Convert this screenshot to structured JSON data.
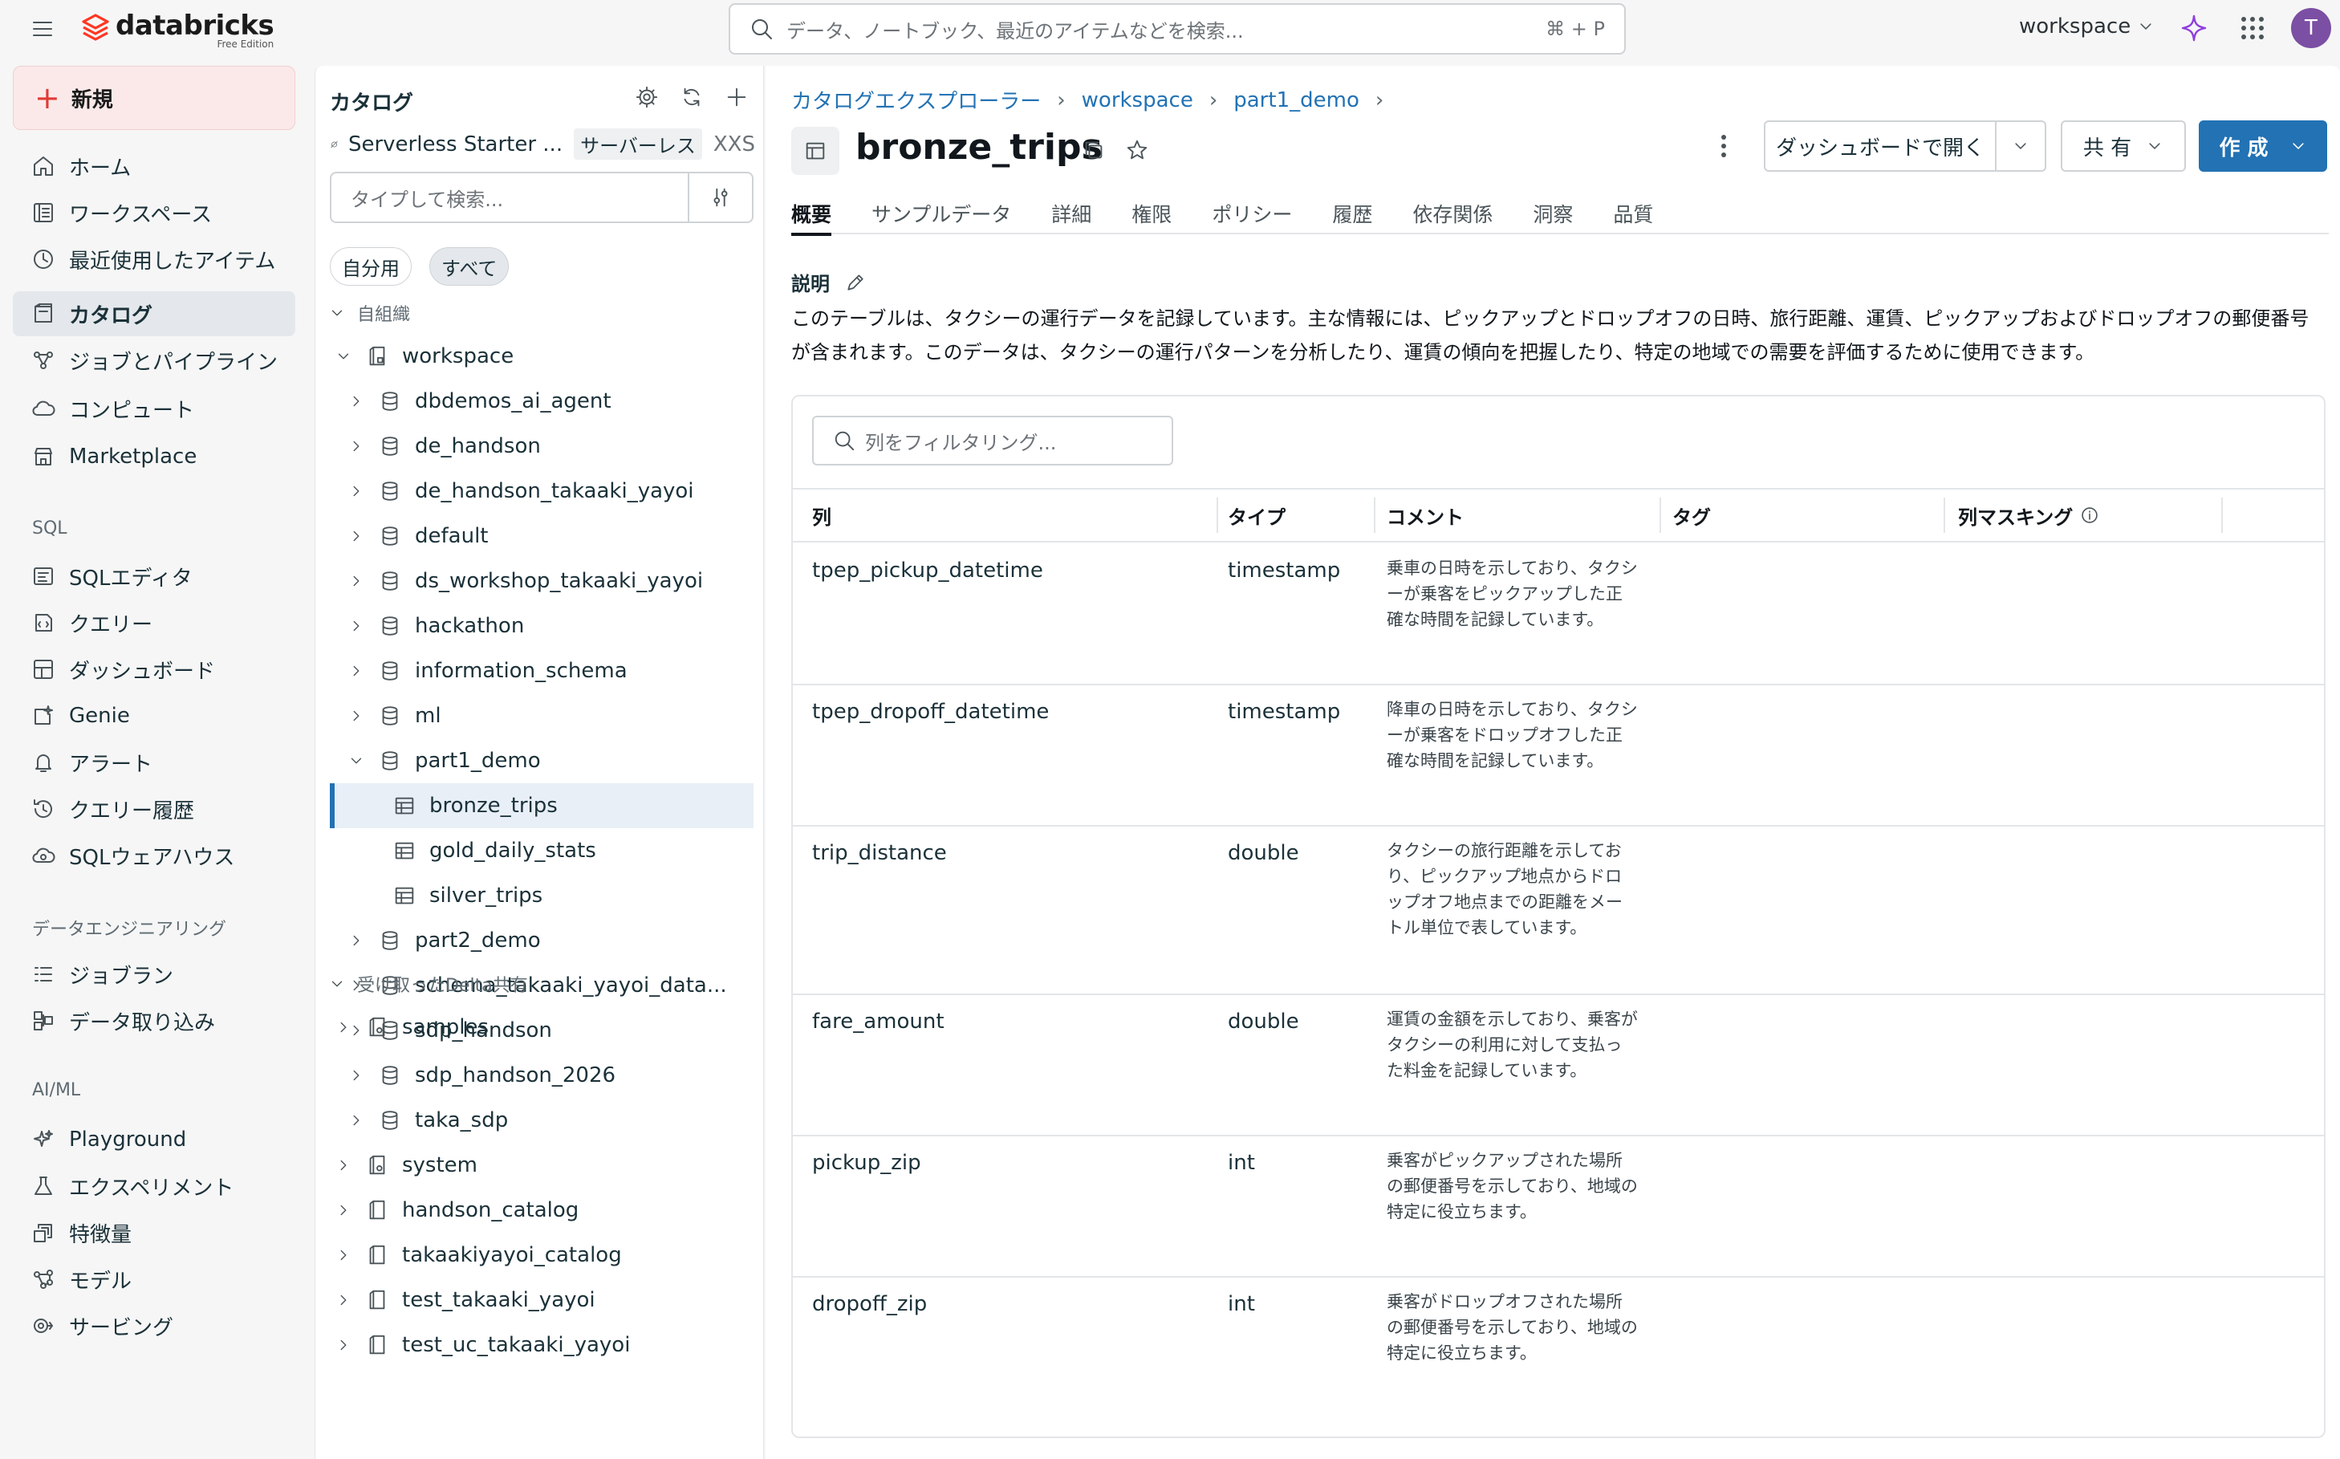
{
  "app": {
    "brand": "databricks",
    "edition": "Free Edition",
    "search_placeholder": "データ、ノートブック、最近のアイテムなどを検索...",
    "search_shortcut": "⌘ + P",
    "workspace": "workspace",
    "avatar_initial": "T"
  },
  "leftnav": {
    "new_label": "新規",
    "items": [
      {
        "label": "ホーム",
        "icon": "home-icon"
      },
      {
        "label": "ワークスペース",
        "icon": "workspace-icon"
      },
      {
        "label": "最近使用したアイテム",
        "icon": "clock-icon"
      },
      {
        "label": "カタログ",
        "icon": "catalog-icon"
      },
      {
        "label": "ジョブとパイプライン",
        "icon": "jobs-icon"
      },
      {
        "label": "コンピュート",
        "icon": "cloud-icon"
      },
      {
        "label": "Marketplace",
        "icon": "store-icon"
      }
    ],
    "sql_header": "SQL",
    "sql_items": [
      {
        "label": "SQLエディタ",
        "icon": "editor-icon"
      },
      {
        "label": "クエリー",
        "icon": "query-icon"
      },
      {
        "label": "ダッシュボード",
        "icon": "dashboard-icon"
      },
      {
        "label": "Genie",
        "icon": "genie-icon"
      },
      {
        "label": "アラート",
        "icon": "bell-icon"
      },
      {
        "label": "クエリー履歴",
        "icon": "history-icon"
      },
      {
        "label": "SQLウェアハウス",
        "icon": "warehouse-icon"
      }
    ],
    "de_header": "データエンジニアリング",
    "de_items": [
      {
        "label": "ジョブラン",
        "icon": "jobrun-icon"
      },
      {
        "label": "データ取り込み",
        "icon": "ingest-icon"
      }
    ],
    "ml_header": "AI/ML",
    "ml_items": [
      {
        "label": "Playground",
        "icon": "playground-icon"
      },
      {
        "label": "エクスペリメント",
        "icon": "flask-icon"
      },
      {
        "label": "特徴量",
        "icon": "feature-icon"
      },
      {
        "label": "モデル",
        "icon": "model-icon"
      },
      {
        "label": "サービング",
        "icon": "serving-icon"
      }
    ]
  },
  "catalog": {
    "title": "カタログ",
    "warehouse_name": "Serverless Starter ...",
    "warehouse_badge": "サーバーレス",
    "warehouse_size": "XXS",
    "search_placeholder": "タイプして検索...",
    "filter_mine": "自分用",
    "filter_all": "すべて",
    "section_org": "自組織",
    "section_shared": "受け取ったDelta共有",
    "tree": [
      {
        "label": "workspace",
        "level": 1,
        "expanded": true,
        "icon": "catalog"
      },
      {
        "label": "dbdemos_ai_agent",
        "level": 2,
        "expanded": false,
        "icon": "schema"
      },
      {
        "label": "de_handson",
        "level": 2,
        "expanded": false,
        "icon": "schema"
      },
      {
        "label": "de_handson_takaaki_yayoi",
        "level": 2,
        "expanded": false,
        "icon": "schema"
      },
      {
        "label": "default",
        "level": 2,
        "expanded": false,
        "icon": "schema"
      },
      {
        "label": "ds_workshop_takaaki_yayoi",
        "level": 2,
        "expanded": false,
        "icon": "schema"
      },
      {
        "label": "hackathon",
        "level": 2,
        "expanded": false,
        "icon": "schema"
      },
      {
        "label": "information_schema",
        "level": 2,
        "expanded": false,
        "icon": "schema"
      },
      {
        "label": "ml",
        "level": 2,
        "expanded": false,
        "icon": "schema"
      },
      {
        "label": "part1_demo",
        "level": 2,
        "expanded": true,
        "icon": "schema"
      },
      {
        "label": "bronze_trips",
        "level": 3,
        "icon": "table",
        "selected": true
      },
      {
        "label": "gold_daily_stats",
        "level": 3,
        "icon": "table"
      },
      {
        "label": "silver_trips",
        "level": 3,
        "icon": "table"
      },
      {
        "label": "part2_demo",
        "level": 2,
        "expanded": false,
        "icon": "schema"
      },
      {
        "label": "schema_takaaki_yayoi_data...",
        "level": 2,
        "expanded": false,
        "icon": "schema"
      },
      {
        "label": "sdp_handson",
        "level": 2,
        "expanded": false,
        "icon": "schema"
      },
      {
        "label": "sdp_handson_2026",
        "level": 2,
        "expanded": false,
        "icon": "schema"
      },
      {
        "label": "taka_sdp",
        "level": 2,
        "expanded": false,
        "icon": "schema"
      },
      {
        "label": "system",
        "level": 1,
        "expanded": false,
        "icon": "syscatalog"
      },
      {
        "label": "handson_catalog",
        "level": 1,
        "expanded": false,
        "icon": "catalog-plain"
      },
      {
        "label": "takaakiyayoi_catalog",
        "level": 1,
        "expanded": false,
        "icon": "catalog-plain"
      },
      {
        "label": "test_takaaki_yayoi",
        "level": 1,
        "expanded": false,
        "icon": "catalog-plain"
      },
      {
        "label": "test_uc_takaaki_yayoi",
        "level": 1,
        "expanded": false,
        "icon": "catalog-plain"
      }
    ],
    "shared": [
      {
        "label": "samples",
        "level": 1,
        "expanded": false,
        "icon": "syscatalog"
      }
    ]
  },
  "main": {
    "breadcrumb": [
      "カタログエクスプローラー",
      "workspace",
      "part1_demo"
    ],
    "title": "bronze_trips",
    "btn_dashboard": "ダッシュボードで開く",
    "btn_share": "共 有",
    "btn_create": "作 成",
    "tabs": [
      "概要",
      "サンプルデータ",
      "詳細",
      "権限",
      "ポリシー",
      "履歴",
      "依存関係",
      "洞察",
      "品質"
    ],
    "desc_label": "説明",
    "description": "このテーブルは、タクシーの運行データを記録しています。主な情報には、ピックアップとドロップオフの日時、旅行距離、運賃、ピックアップおよびドロップオフの郵便番号が含まれます。このデータは、タクシーの運行パターンを分析したり、運賃の傾向を把握したり、特定の地域での需要を評価するために使用できます。",
    "col_filter_placeholder": "列をフィルタリング...",
    "headers": [
      "列",
      "タイプ",
      "コメント",
      "タグ",
      "列マスキング"
    ],
    "columns": [
      {
        "name": "tpep_pickup_datetime",
        "type": "timestamp",
        "comment": "乗車の日時を示しており、タクシーが乗客をピックアップした正確な時間を記録しています。"
      },
      {
        "name": "tpep_dropoff_datetime",
        "type": "timestamp",
        "comment": "降車の日時を示しており、タクシーが乗客をドロップオフした正確な時間を記録しています。"
      },
      {
        "name": "trip_distance",
        "type": "double",
        "comment": "タクシーの旅行距離を示しており、ピックアップ地点からドロップオフ地点までの距離をメートル単位で表しています。"
      },
      {
        "name": "fare_amount",
        "type": "double",
        "comment": "運賃の金額を示しており、乗客がタクシーの利用に対して支払った料金を記録しています。"
      },
      {
        "name": "pickup_zip",
        "type": "int",
        "comment": "乗客がピックアップされた場所の郵便番号を示しており、地域の特定に役立ちます。"
      },
      {
        "name": "dropoff_zip",
        "type": "int",
        "comment": "乗客がドロップオフされた場所の郵便番号を示しており、地域の特定に役立ちます。"
      }
    ]
  },
  "colors": {
    "accent": "#2272b4",
    "brand_red": "#ff3621",
    "selected_row": "#e8eff7"
  }
}
